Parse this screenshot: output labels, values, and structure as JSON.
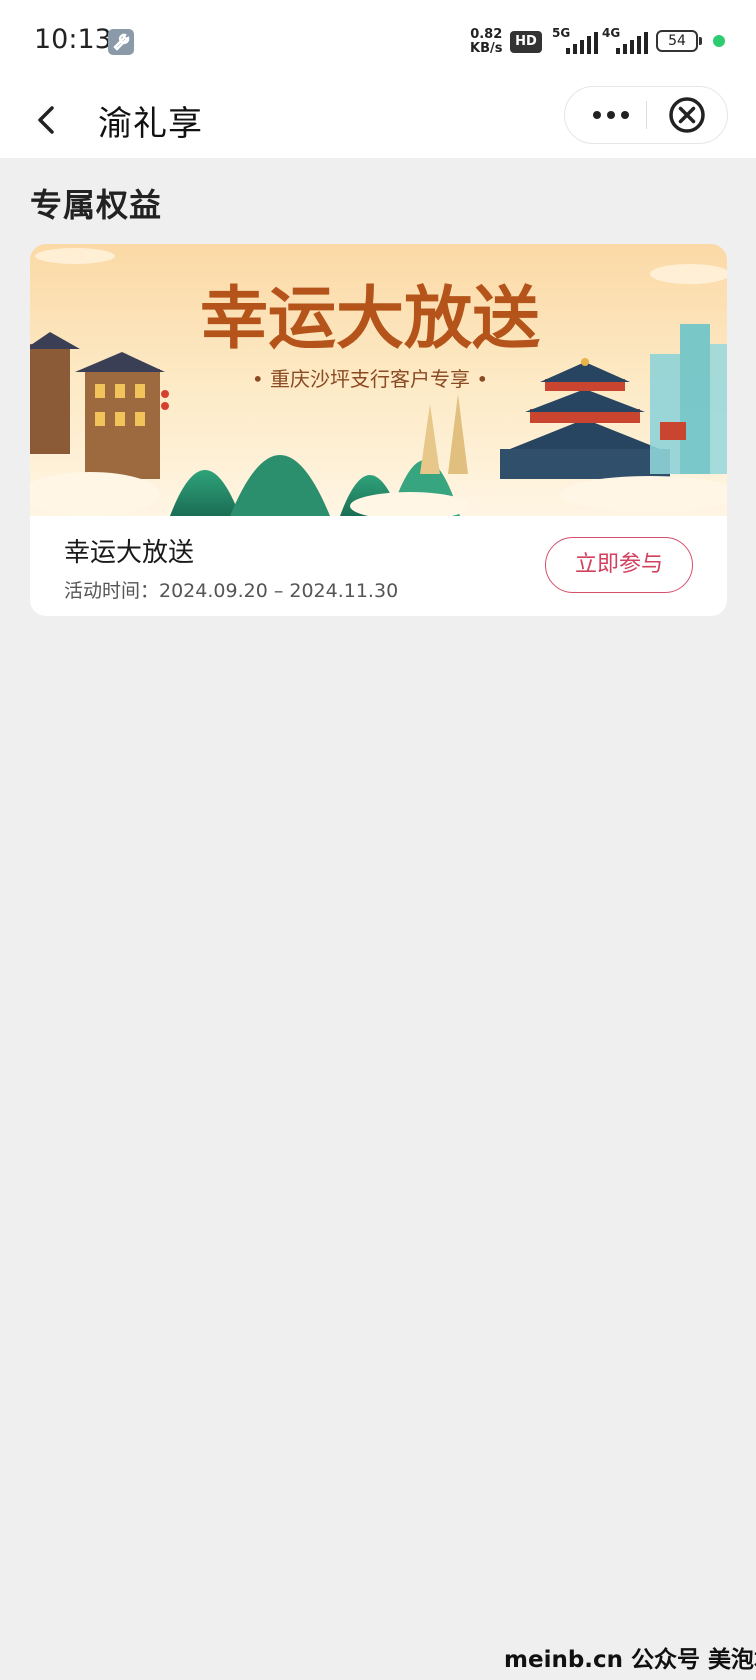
{
  "status_bar": {
    "time": "10:13",
    "net_speed_value": "0.82",
    "net_speed_unit": "KB/s",
    "hd_label": "HD",
    "signal_1_label": "5G",
    "signal_2_label": "4G",
    "battery": "54"
  },
  "nav": {
    "title": "渝礼享"
  },
  "section": {
    "title": "专属权益"
  },
  "card": {
    "banner_title": "幸运大放送",
    "banner_subtitle": "• 重庆沙坪支行客户专享 •",
    "title": "幸运大放送",
    "date": "活动时间：2024.09.20 – 2024.11.30",
    "button_label": "立即参与"
  },
  "watermark": "meinb.cn  公众号 美泡君",
  "colors": {
    "accent": "#d3405e",
    "page_bg": "#efefef",
    "banner_title": "#b5541a"
  }
}
